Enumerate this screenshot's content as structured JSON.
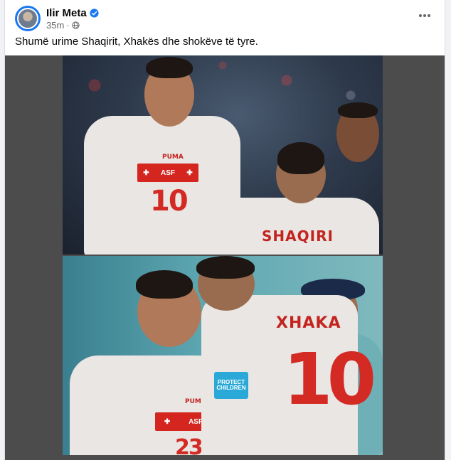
{
  "post": {
    "author": "Ilir Meta",
    "timestamp": "35m",
    "caption": "Shumë urime Shaqirit, Xhakës dhe shokëve të tyre.",
    "more_label": "⋯",
    "icons": {
      "verified": "verified-badge-icon",
      "privacy": "globe-icon",
      "more": "more-options-icon"
    },
    "colors": {
      "verified": "#1877f2",
      "meta_text": "#65676b"
    }
  },
  "photo_top": {
    "jersey_left_number": "10",
    "jersey_right_name": "SHAQIRI",
    "brand": "PUMA",
    "patch_label": "ASF"
  },
  "photo_bottom": {
    "jersey_right_name": "XHAKA",
    "jersey_right_number": "10",
    "armband_text": "PROTECT CHILDREN",
    "brand": "PUMA",
    "patch_label": "ASF",
    "jersey_left_number": "23"
  }
}
